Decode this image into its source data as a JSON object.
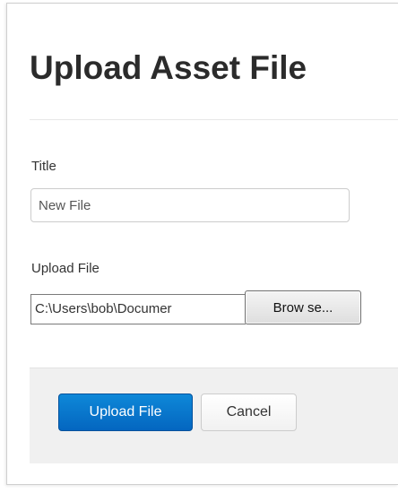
{
  "dialog": {
    "title": "Upload Asset File"
  },
  "form": {
    "title_label": "Title",
    "title_value": "New File",
    "file_label": "Upload File",
    "file_path": "C:\\Users\\bob\\Documer",
    "browse_label": "Brow se..."
  },
  "footer": {
    "upload_label": "Upload File",
    "cancel_label": "Cancel"
  },
  "colors": {
    "primary_button": "#0470c8",
    "footer_background": "#f0f0f0",
    "title_text": "#2b2b2b"
  }
}
